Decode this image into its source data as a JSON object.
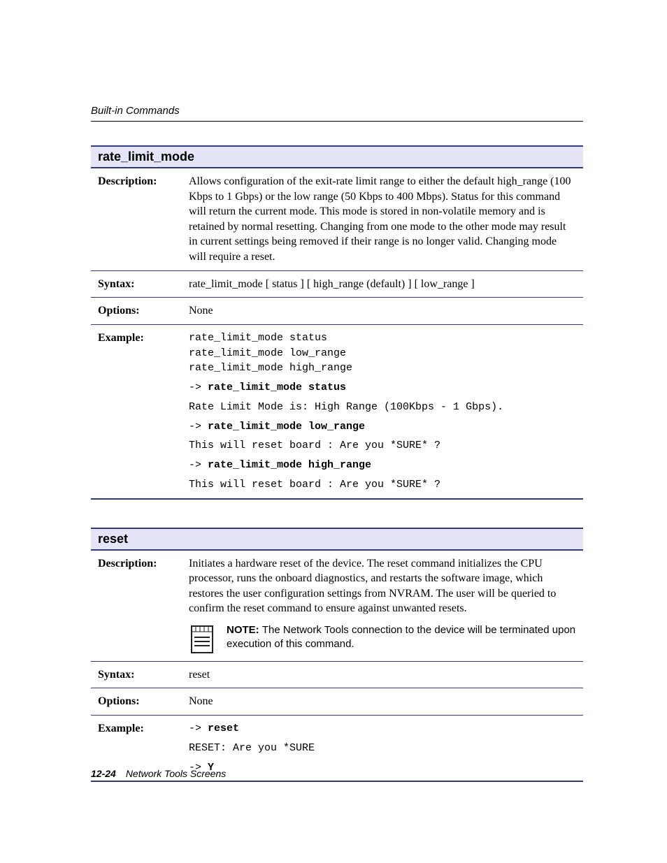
{
  "header": {
    "running": "Built-in Commands"
  },
  "footer": {
    "page": "12-24",
    "title": "Network Tools Screens"
  },
  "cmd1": {
    "title": "rate_limit_mode",
    "rows": {
      "desc_label": "Description:",
      "desc_text": "Allows configuration of the exit-rate limit range to either the default high_range (100 Kbps to 1 Gbps) or the low range (50 Kbps to 400 Mbps). Status for this command will return the current mode. This mode is stored in non-volatile memory and is retained by normal resetting. Changing from one mode to the other mode may result in current settings being removed if their range is no longer valid. Changing mode will require a reset.",
      "syntax_label": "Syntax:",
      "syntax_text": "rate_limit_mode [ status ] [ high_range (default) ] [ low_range ]",
      "options_label": "Options:",
      "options_text": "None",
      "example_label": "Example:",
      "ex_plain1": "rate_limit_mode status",
      "ex_plain2": "rate_limit_mode low_range",
      "ex_plain3": "rate_limit_mode high_range",
      "ex_prompt1a": "-> ",
      "ex_bold1": "rate_limit_mode status",
      "ex_out1": "Rate Limit Mode is: High Range (100Kbps - 1 Gbps).",
      "ex_prompt2a": "-> ",
      "ex_bold2": "rate_limit_mode low_range",
      "ex_out2": "This will reset board : Are you *SURE* ?",
      "ex_prompt3a": "-> ",
      "ex_bold3": "rate_limit_mode high_range",
      "ex_out3": "This will reset board : Are you *SURE* ?"
    }
  },
  "cmd2": {
    "title": "reset",
    "rows": {
      "desc_label": "Description:",
      "desc_text": "Initiates a hardware reset of the device. The reset command initializes the CPU processor, runs the onboard diagnostics, and restarts the software image, which restores the user configuration settings from NVRAM. The user will be queried to confirm the reset command to ensure against unwanted resets.",
      "note_label": "NOTE:",
      "note_text": "The Network Tools connection to the device will be terminated upon execution of this command.",
      "syntax_label": "Syntax:",
      "syntax_text": "reset",
      "options_label": "Options:",
      "options_text": "None",
      "example_label": "Example:",
      "ex_prompt1a": "-> ",
      "ex_bold1": "reset",
      "ex_out1": "RESET: Are you *SURE",
      "ex_prompt2a": "-> ",
      "ex_bold2": "Y"
    }
  }
}
